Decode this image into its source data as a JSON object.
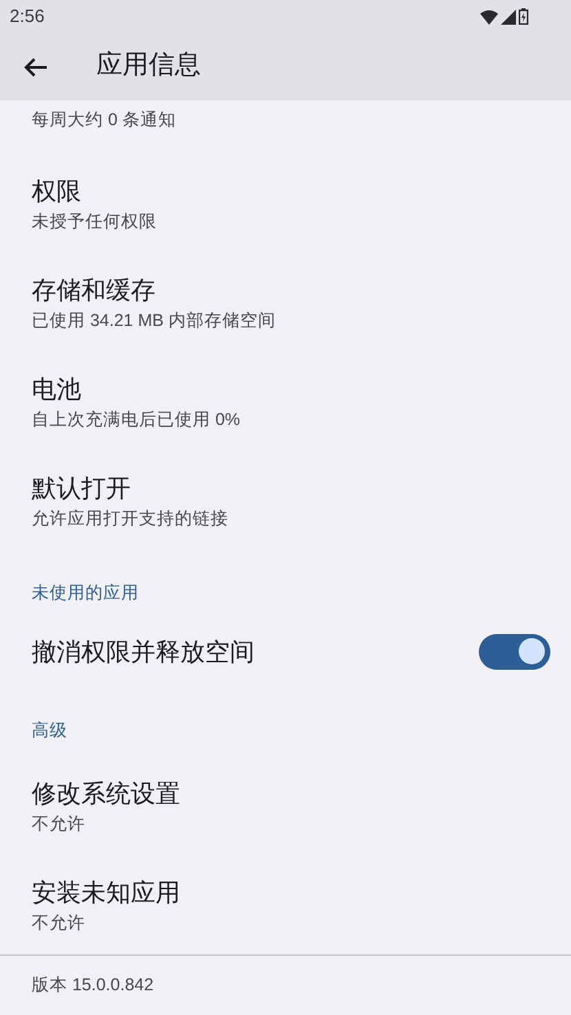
{
  "status_bar": {
    "time": "2:56"
  },
  "app_bar": {
    "title": "应用信息"
  },
  "rows": [
    {
      "kind": "partial",
      "summary": "每周大约 0 条通知"
    },
    {
      "kind": "item",
      "title": "权限",
      "summary": "未授予任何权限"
    },
    {
      "kind": "item",
      "title": "存储和缓存",
      "summary": "已使用 34.21 MB 内部存储空间"
    },
    {
      "kind": "item",
      "title": "电池",
      "summary": "自上次充满电后已使用 0%"
    },
    {
      "kind": "item",
      "title": "默认打开",
      "summary": "允许应用打开支持的链接"
    },
    {
      "kind": "header",
      "title": "未使用的应用"
    },
    {
      "kind": "switch",
      "title": "撤消权限并释放空间",
      "on": true
    },
    {
      "kind": "header",
      "title": "高级"
    },
    {
      "kind": "item",
      "title": "修改系统设置",
      "summary": "不允许"
    },
    {
      "kind": "item",
      "title": "安装未知应用",
      "summary": "不允许"
    }
  ],
  "footer": {
    "version": "版本 15.0.0.842"
  }
}
